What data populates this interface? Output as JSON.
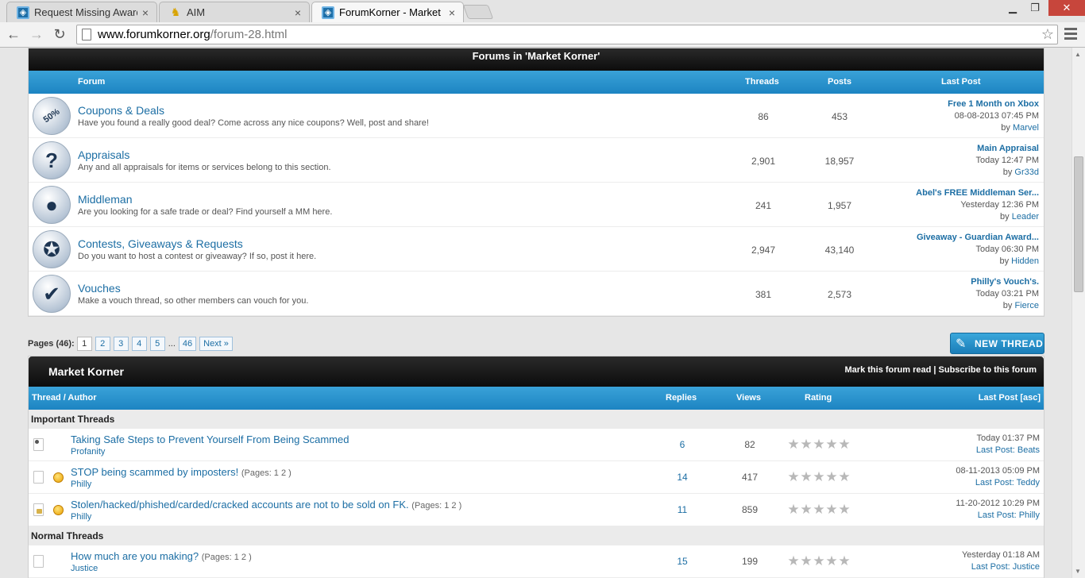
{
  "browser": {
    "tabs": [
      {
        "title": "Request Missing Awards",
        "icon": "fk-favicon"
      },
      {
        "title": "AIM",
        "icon": "aim-favicon"
      },
      {
        "title": "ForumKorner - Market Kor",
        "icon": "fk-favicon",
        "active": true
      }
    ],
    "url_host": "www.forumkorner.org",
    "url_path": "/forum-28.html"
  },
  "forums_box": {
    "title": "Forums in 'Market Korner'",
    "columns": {
      "forum": "Forum",
      "threads": "Threads",
      "posts": "Posts",
      "last_post": "Last Post"
    },
    "rows": [
      {
        "icon": "coupon-tag-icon",
        "icon_glyph": "50%",
        "title": "Coupons & Deals",
        "desc": "Have you found a really good deal? Come across any nice coupons? Well, post and share!",
        "threads": "86",
        "posts": "453",
        "lp_title": "Free 1 Month on Xbox",
        "lp_date": "08-08-2013 07:45 PM",
        "lp_by": "by",
        "lp_user": "Marvel"
      },
      {
        "icon": "question-mark-icon",
        "icon_glyph": "?",
        "title": "Appraisals",
        "desc": "Any and all appraisals for items or services belong to this section.",
        "threads": "2,901",
        "posts": "18,957",
        "lp_title": "Main Appraisal",
        "lp_date": "Today 12:47 PM",
        "lp_by": "by",
        "lp_user": "Gr33d"
      },
      {
        "icon": "person-icon",
        "icon_glyph": "●",
        "title": "Middleman",
        "desc": "Are you looking for a safe trade or deal? Find yourself a MM here.",
        "threads": "241",
        "posts": "1,957",
        "lp_title": "Abel's FREE Middleman Ser...",
        "lp_date": "Yesterday 12:36 PM",
        "lp_by": "by",
        "lp_user": "Leader"
      },
      {
        "icon": "ribbon-badge-icon",
        "icon_glyph": "✪",
        "title": "Contests, Giveaways & Requests",
        "desc": "Do you want to host a contest or giveaway? If so, post it here.",
        "threads": "2,947",
        "posts": "43,140",
        "lp_title": "Giveaway - Guardian Award...",
        "lp_date": "Today 06:30 PM",
        "lp_by": "by",
        "lp_user": "Hidden"
      },
      {
        "icon": "checkmark-icon",
        "icon_glyph": "✔",
        "title": "Vouches",
        "desc": "Make a vouch thread, so other members can vouch for you.",
        "threads": "381",
        "posts": "2,573",
        "lp_title": "Philly's Vouch's.",
        "lp_date": "Today 03:21 PM",
        "lp_by": "by",
        "lp_user": "Fierce"
      }
    ]
  },
  "pagination": {
    "label": "Pages (46):",
    "pages": [
      "1",
      "2",
      "3",
      "4",
      "5"
    ],
    "dots": "...",
    "last": "46",
    "next": "Next »"
  },
  "new_thread_label": "NEW THREAD",
  "threads_box": {
    "title": "Market Korner",
    "mark_read": "Mark this forum read",
    "separator": "|",
    "subscribe": "Subscribe to this forum",
    "columns": {
      "thread": "Thread / Author",
      "replies": "Replies",
      "views": "Views",
      "rating": "Rating",
      "last_post": "Last Post [asc]"
    },
    "important_label": "Important Threads",
    "normal_label": "Normal Threads",
    "important": [
      {
        "title": "Taking Safe Steps to Prevent Yourself From Being Scammed",
        "pages": "",
        "author": "Profanity",
        "replies": "6",
        "views": "82",
        "lp_date": "Today 01:37 PM",
        "lp_prefix": "Last Post:",
        "lp_user": "Beats",
        "status": "dot",
        "smiley": false
      },
      {
        "title": "STOP being scammed by imposters!",
        "pages": "(Pages: 1 2 )",
        "author": "Philly",
        "replies": "14",
        "views": "417",
        "lp_date": "08-11-2013 05:09 PM",
        "lp_prefix": "Last Post:",
        "lp_user": "Teddy",
        "status": "plain",
        "smiley": true
      },
      {
        "title": "Stolen/hacked/phished/carded/cracked accounts are not to be sold on FK.",
        "pages": "(Pages: 1 2 )",
        "author": "Philly",
        "replies": "11",
        "views": "859",
        "lp_date": "11-20-2012 10:29 PM",
        "lp_prefix": "Last Post:",
        "lp_user": "Philly",
        "status": "lock",
        "smiley": true
      }
    ],
    "normal": [
      {
        "title": "How much are you making?",
        "pages": "(Pages: 1 2 )",
        "author": "Justice",
        "replies": "15",
        "views": "199",
        "lp_date": "Yesterday 01:18 AM",
        "lp_prefix": "Last Post:",
        "lp_user": "Justice",
        "status": "plain",
        "smiley": false
      }
    ],
    "rating_max": 5,
    "rating_value": 0
  },
  "colors": {
    "accent_blue": "#1c6ea4",
    "header_blue": "#2a96d0",
    "dark_header": "#111111"
  }
}
